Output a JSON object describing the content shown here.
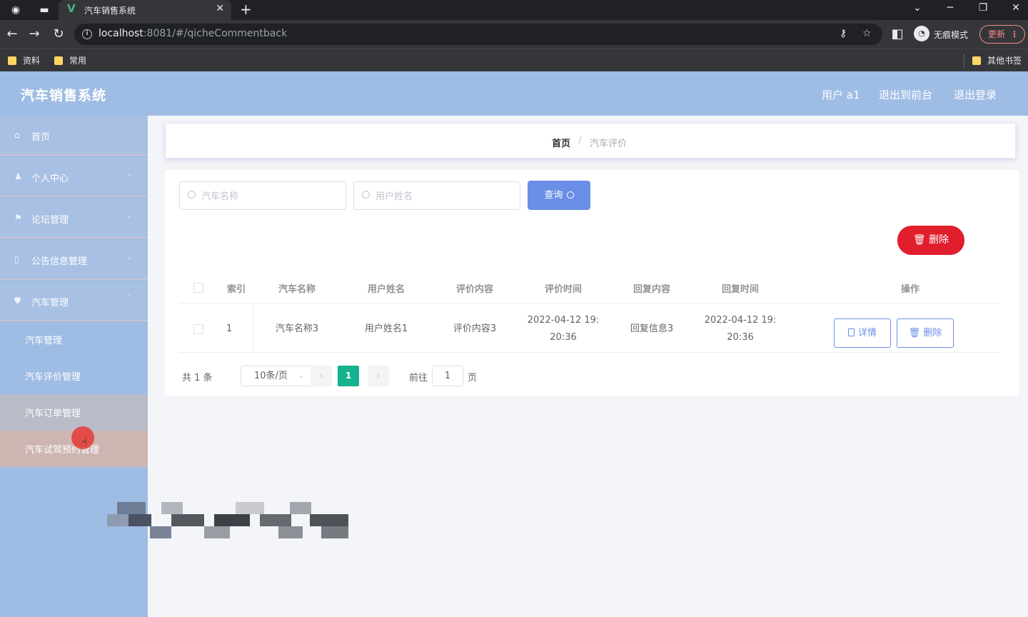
{
  "browser": {
    "tab_title": "汽车销售系统",
    "tab_favicon": "V",
    "url_host": "localhost",
    "url_path": ":8081/#/qicheCommentback",
    "incognito_label": "无痕模式",
    "update_label": "更新",
    "bookmarks": [
      "资料",
      "常用"
    ],
    "other_bookmarks": "其他书签"
  },
  "header": {
    "title": "汽车销售系统",
    "user_label": "用户 a1",
    "back_to_front": "退出到前台",
    "logout": "退出登录"
  },
  "sidebar": {
    "menus": [
      {
        "label": "首页",
        "icon": "home-icon"
      },
      {
        "label": "个人中心",
        "icon": "user-icon"
      },
      {
        "label": "论坛管理",
        "icon": "flag-icon"
      },
      {
        "label": "公告信息管理",
        "icon": "document-icon"
      },
      {
        "label": "汽车管理",
        "icon": "shield-icon"
      }
    ],
    "submenu": [
      "汽车管理",
      "汽车评价管理",
      "汽车订单管理",
      "汽车试驾预约管理"
    ]
  },
  "breadcrumb": {
    "home": "首页",
    "separator": "/",
    "current": "汽车评价"
  },
  "search": {
    "car_name_placeholder": "汽车名称",
    "user_name_placeholder": "用户姓名",
    "query_label": "查询"
  },
  "actions": {
    "bulk_delete": "删除"
  },
  "table": {
    "columns": [
      "索引",
      "汽车名称",
      "用户姓名",
      "评价内容",
      "评价时间",
      "回复内容",
      "回复时间",
      "操作"
    ],
    "rows": [
      {
        "index": "1",
        "car_name": "汽车名称3",
        "user_name": "用户姓名1",
        "content": "评价内容3",
        "comment_time_l1": "2022-04-12 19:",
        "comment_time_l2": "20:36",
        "reply": "回复信息3",
        "reply_time_l1": "2022-04-12 19:",
        "reply_time_l2": "20:36",
        "detail_label": "详情",
        "delete_label": "删除"
      }
    ]
  },
  "pagination": {
    "total_text": "共 1 条",
    "page_size": "10条/页",
    "current_page": "1",
    "goto_label": "前往",
    "goto_value": "1",
    "page_suffix": "页"
  },
  "colors": {
    "header_bg": "#9fbce4",
    "primary": "#6b8fe6",
    "danger": "#e01e2c",
    "page_active": "#16b28f"
  }
}
